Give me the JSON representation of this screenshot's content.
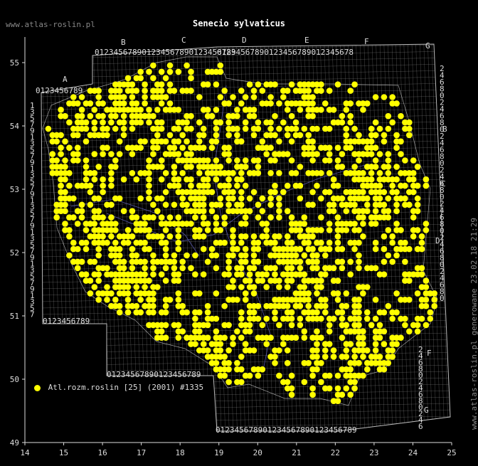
{
  "site": "www.atlas-roslin.pl",
  "title": "Senecio sylvaticus",
  "legend": {
    "label": "Atl.rozm.roslin [25] (2001) #1335",
    "color": "#ffff00"
  },
  "footer": "www.atlas-roslin.pl generowane 23.02.18 21:29",
  "x_ticks": [
    "14",
    "15",
    "16",
    "17",
    "18",
    "19",
    "20",
    "21",
    "22",
    "23",
    "24",
    "25"
  ],
  "y_ticks": [
    "55",
    "54",
    "53",
    "52",
    "51",
    "50",
    "49"
  ],
  "col_letters": [
    "A",
    "B",
    "C",
    "D",
    "E",
    "F",
    "G"
  ],
  "row_letters": [
    "B",
    "C",
    "D",
    "E",
    "F",
    "G"
  ],
  "grid_digits": "0123456789",
  "colors": {
    "background": "#000000",
    "grid": "#aaaaaa",
    "dot": "#ffff00",
    "rivers": "#6666cc",
    "border": "#ffffff"
  }
}
